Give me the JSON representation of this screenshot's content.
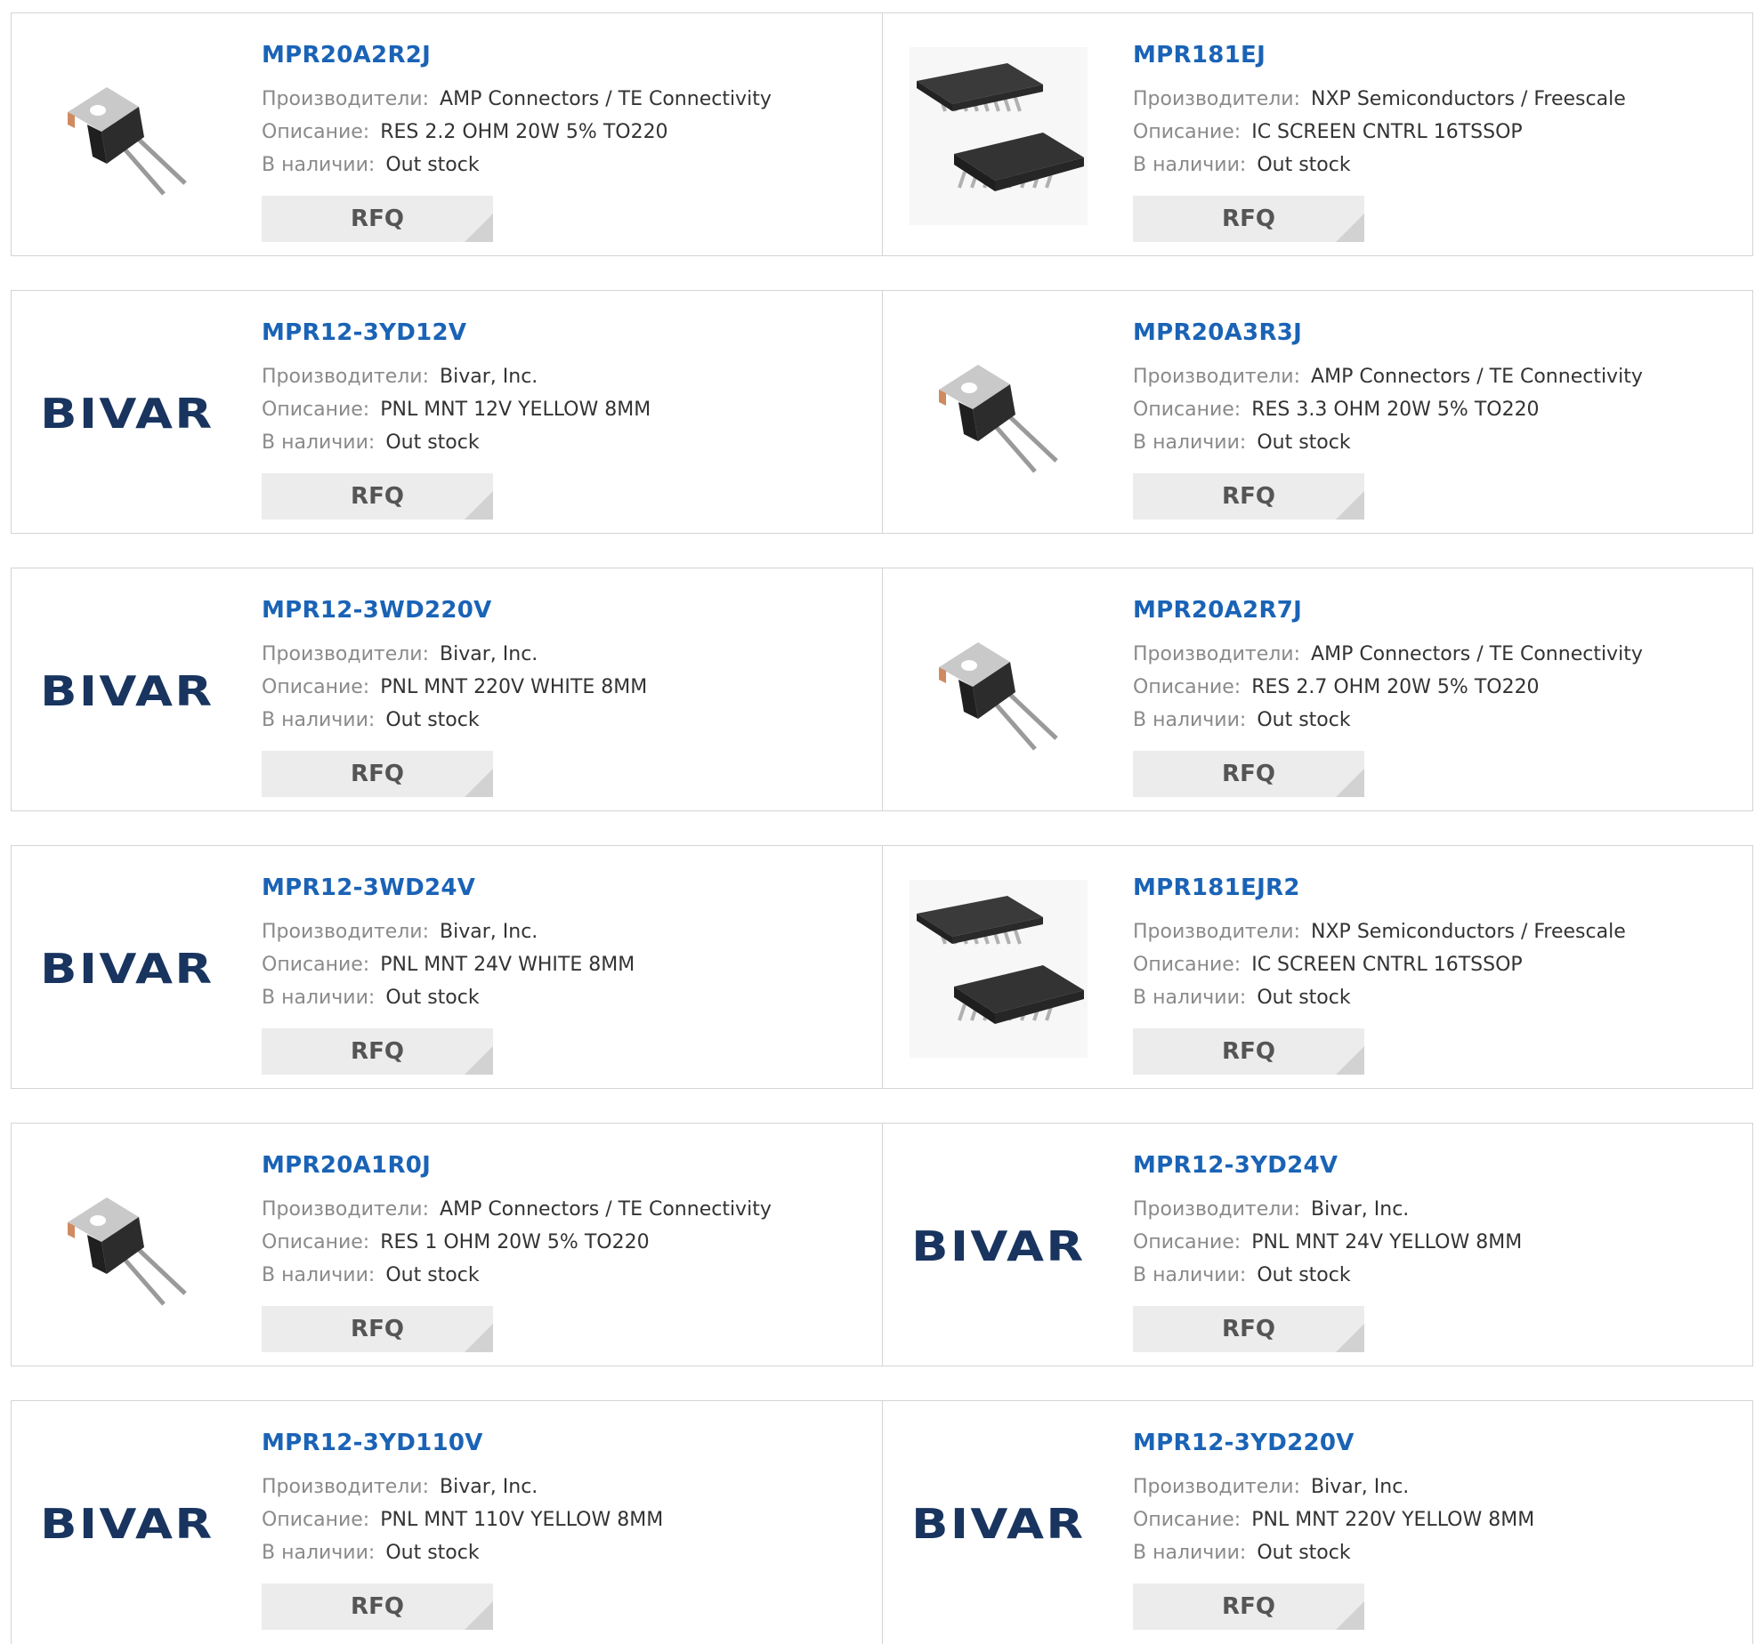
{
  "labels": {
    "manufacturer": "Производители:",
    "description": "Описание:",
    "availability": "В наличии:",
    "rfq": "RFQ"
  },
  "colors": {
    "link": "#1a63b6",
    "label": "#8a8a8a",
    "button_bg": "#ececec",
    "bivar_logo": "#18345f"
  },
  "products": [
    {
      "pn": "MPR20A2R2J",
      "manufacturer": "AMP Connectors / TE Connectivity",
      "description": "RES 2.2 OHM 20W 5% TO220",
      "stock": "Out stock",
      "image": "to220-resistor-image"
    },
    {
      "pn": "MPR181EJ",
      "manufacturer": "NXP Semiconductors / Freescale",
      "description": "IC SCREEN CNTRL 16TSSOP",
      "stock": "Out stock",
      "image": "tssop-chip-image"
    },
    {
      "pn": "MPR12-3YD12V",
      "manufacturer": "Bivar, Inc.",
      "description": "PNL MNT 12V YELLOW 8MM",
      "stock": "Out stock",
      "image": "bivar-logo",
      "logo_text": "BIVAR"
    },
    {
      "pn": "MPR20A3R3J",
      "manufacturer": "AMP Connectors / TE Connectivity",
      "description": "RES 3.3 OHM 20W 5% TO220",
      "stock": "Out stock",
      "image": "to220-resistor-image"
    },
    {
      "pn": "MPR12-3WD220V",
      "manufacturer": "Bivar, Inc.",
      "description": "PNL MNT 220V WHITE 8MM",
      "stock": "Out stock",
      "image": "bivar-logo",
      "logo_text": "BIVAR"
    },
    {
      "pn": "MPR20A2R7J",
      "manufacturer": "AMP Connectors / TE Connectivity",
      "description": "RES 2.7 OHM 20W 5% TO220",
      "stock": "Out stock",
      "image": "to220-resistor-image"
    },
    {
      "pn": "MPR12-3WD24V",
      "manufacturer": "Bivar, Inc.",
      "description": "PNL MNT 24V WHITE 8MM",
      "stock": "Out stock",
      "image": "bivar-logo",
      "logo_text": "BIVAR"
    },
    {
      "pn": "MPR181EJR2",
      "manufacturer": "NXP Semiconductors / Freescale",
      "description": "IC SCREEN CNTRL 16TSSOP",
      "stock": "Out stock",
      "image": "tssop-chip-image"
    },
    {
      "pn": "MPR20A1R0J",
      "manufacturer": "AMP Connectors / TE Connectivity",
      "description": "RES 1 OHM 20W 5% TO220",
      "stock": "Out stock",
      "image": "to220-resistor-image"
    },
    {
      "pn": "MPR12-3YD24V",
      "manufacturer": "Bivar, Inc.",
      "description": "PNL MNT 24V YELLOW 8MM",
      "stock": "Out stock",
      "image": "bivar-logo",
      "logo_text": "BIVAR"
    },
    {
      "pn": "MPR12-3YD110V",
      "manufacturer": "Bivar, Inc.",
      "description": "PNL MNT 110V YELLOW 8MM",
      "stock": "Out stock",
      "image": "bivar-logo",
      "logo_text": "BIVAR"
    },
    {
      "pn": "MPR12-3YD220V",
      "manufacturer": "Bivar, Inc.",
      "description": "PNL MNT 220V YELLOW 8MM",
      "stock": "Out stock",
      "image": "bivar-logo",
      "logo_text": "BIVAR"
    }
  ]
}
